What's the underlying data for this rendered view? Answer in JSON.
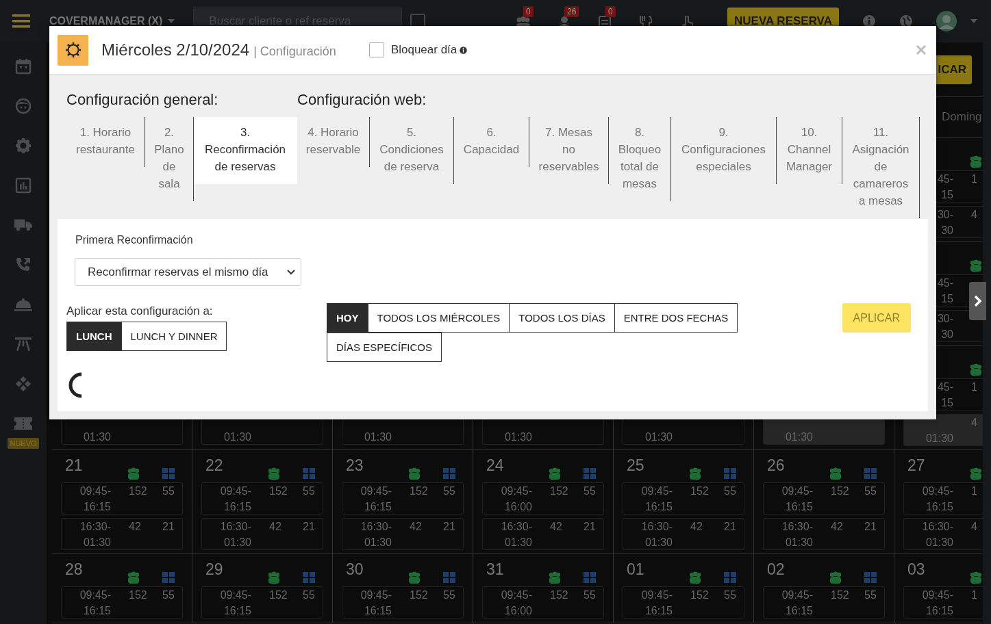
{
  "top_bar": {
    "brand": "COVERMANAGER (X)",
    "search": {
      "placeholder": "Buscar cliente o ref reserva"
    },
    "filter_checked": false,
    "notifications": [
      {
        "count": "0"
      },
      {
        "count": "26"
      },
      {
        "count": "0"
      }
    ],
    "new_button": "NUEVA RESERVA"
  },
  "sidebar": {
    "new_badge": "NUEVO"
  },
  "background": {
    "apply_button": "ICAR",
    "calendar": {
      "header": "Doming",
      "weeks": [
        {
          "cells": [
            {},
            {},
            {},
            {},
            {},
            {},
            {
              "people_icon": true,
              "slots": [
                {
                  "time_start": "45-",
                  "time_end": "15",
                  "covers": "1",
                  "shaded": false
                },
                {
                  "time_start": "30-",
                  "time_end": "30",
                  "covers": "4",
                  "shaded": false
                }
              ]
            }
          ]
        },
        {
          "cells": [
            {},
            {},
            {},
            {},
            {},
            {},
            {
              "people_icon": true,
              "slots": [
                {
                  "time_start": "45-",
                  "time_end": "15",
                  "shaded": false
                },
                {
                  "time_start": "30-",
                  "time_end": "30",
                  "shaded": false
                }
              ]
            }
          ]
        },
        {
          "cells": [
            {
              "slots": [
                {
                  "time_end": "01:30",
                  "shaded": false
                }
              ]
            },
            {
              "slots": [
                {
                  "time_end": "01:30",
                  "shaded": false
                }
              ]
            },
            {
              "slots": [
                {
                  "time_end": "01:30",
                  "shaded": false
                }
              ]
            },
            {
              "slots": [
                {
                  "time_end": "01:30",
                  "shaded": false
                }
              ]
            },
            {
              "slots": [
                {
                  "time_end": "01:30",
                  "shaded": false
                }
              ]
            },
            {
              "slots": [
                {
                  "time_end": "01:30",
                  "shaded": true
                }
              ]
            },
            {
              "people_icon": true,
              "slots": [
                {
                  "time_start": "45-",
                  "time_end": "15",
                  "covers": "1",
                  "shaded": false
                },
                {
                  "time_end": "01:30",
                  "covers": "4",
                  "shaded": true
                }
              ]
            }
          ]
        },
        {
          "cells": [
            {
              "day": "21",
              "people_icon": true,
              "tables_icon": true,
              "slots": [
                {
                  "time_start": "09:45-",
                  "time_end": "16:15",
                  "covers": "152",
                  "tables": "55",
                  "shaded": false
                },
                {
                  "time_start": "16:30-",
                  "time_end": "01:30",
                  "covers": "42",
                  "tables": "21",
                  "shaded": false
                }
              ]
            },
            {
              "day": "22",
              "people_icon": true,
              "tables_icon": true,
              "slots": [
                {
                  "time_start": "09:45-",
                  "time_end": "16:15",
                  "covers": "152",
                  "tables": "55",
                  "shaded": false
                },
                {
                  "time_start": "16:30-",
                  "time_end": "01:30",
                  "covers": "42",
                  "tables": "21",
                  "shaded": false
                }
              ]
            },
            {
              "day": "23",
              "people_icon": true,
              "tables_icon": true,
              "slots": [
                {
                  "time_start": "09:45-",
                  "time_end": "16:15",
                  "covers": "152",
                  "tables": "55",
                  "shaded": false
                },
                {
                  "time_start": "16:30-",
                  "time_end": "01:30",
                  "covers": "42",
                  "tables": "21",
                  "shaded": false
                }
              ]
            },
            {
              "day": "24",
              "people_icon": true,
              "tables_icon": true,
              "slots": [
                {
                  "time_start": "09:45-",
                  "time_end": "16:00",
                  "covers": "152",
                  "tables": "55",
                  "shaded": false
                },
                {
                  "time_start": "16:30-",
                  "time_end": "01:30",
                  "covers": "42",
                  "tables": "21",
                  "shaded": false
                }
              ]
            },
            {
              "day": "25",
              "people_icon": true,
              "tables_icon": true,
              "slots": [
                {
                  "time_start": "09:45-",
                  "time_end": "16:15",
                  "covers": "152",
                  "tables": "55",
                  "shaded": false
                },
                {
                  "time_start": "16:30-",
                  "time_end": "01:30",
                  "covers": "42",
                  "tables": "21",
                  "shaded": false
                }
              ]
            },
            {
              "day": "26",
              "people_icon": true,
              "tables_icon": true,
              "slots": [
                {
                  "time_start": "09:45-",
                  "time_end": "16:15",
                  "covers": "152",
                  "tables": "55",
                  "shaded": false
                },
                {
                  "time_start": "16:30-",
                  "time_end": "01:30",
                  "covers": "42",
                  "tables": "21",
                  "shaded": false
                }
              ]
            },
            {
              "day": "27",
              "people_icon": true,
              "slots": [
                {
                  "time_start": "09:45-",
                  "time_end": "16:15",
                  "covers": "1",
                  "shaded": false
                },
                {
                  "time_start": "16:30-",
                  "time_end": "01:30",
                  "covers": "4",
                  "shaded": false
                }
              ]
            }
          ]
        },
        {
          "cells": [
            {
              "day": "28",
              "people_icon": true,
              "tables_icon": true,
              "slots": [
                {
                  "time_start": "09:45-",
                  "time_end": "16:15",
                  "covers": "152",
                  "tables": "55",
                  "shaded": false
                }
              ]
            },
            {
              "day": "29",
              "people_icon": true,
              "tables_icon": true,
              "slots": [
                {
                  "time_start": "09:45-",
                  "time_end": "16:15",
                  "covers": "152",
                  "tables": "55",
                  "shaded": false
                }
              ]
            },
            {
              "day": "30",
              "people_icon": true,
              "tables_icon": true,
              "slots": [
                {
                  "time_start": "09:45-",
                  "time_end": "16:15",
                  "covers": "152",
                  "tables": "55",
                  "shaded": false
                }
              ]
            },
            {
              "day": "31",
              "people_icon": true,
              "tables_icon": true,
              "slots": [
                {
                  "time_start": "09:45-",
                  "time_end": "16:00",
                  "covers": "152",
                  "tables": "55",
                  "shaded": false
                }
              ]
            },
            {
              "day": "01",
              "people_icon": true,
              "tables_icon": true,
              "slots": [
                {
                  "time_start": "09:45-",
                  "time_end": "16:15",
                  "covers": "152",
                  "tables": "55",
                  "shaded": false
                }
              ]
            },
            {
              "day": "02",
              "people_icon": true,
              "tables_icon": true,
              "slots": [
                {
                  "time_start": "09:45-",
                  "time_end": "16:15",
                  "covers": "152",
                  "tables": "55",
                  "shaded": false
                }
              ]
            },
            {
              "day": "03",
              "people_icon": true,
              "slots": [
                {
                  "time_start": "09:45-",
                  "time_end": "16:15",
                  "covers": "1",
                  "shaded": false
                }
              ]
            }
          ]
        }
      ]
    }
  },
  "modal": {
    "title": "Miércoles 2/10/2024",
    "subtitle": "| Configuración",
    "block_day": {
      "label": "Bloquear día",
      "checked": false
    },
    "sections": [
      "Configuración general:",
      "Configuración web:"
    ],
    "tabs": [
      {
        "label": "1. Horario restaurante",
        "selected": false
      },
      {
        "label": "2. Plano de sala",
        "selected": false
      },
      {
        "label": "3. Reconfirmación de reservas",
        "selected": true
      },
      {
        "label": "4. Horario reservable",
        "selected": false
      },
      {
        "label": "5. Condiciones de reserva",
        "selected": false
      },
      {
        "label": "6. Capacidad",
        "selected": false
      },
      {
        "label": "7. Mesas no reservables",
        "selected": false
      },
      {
        "label": "8. Bloqueo total de mesas",
        "selected": false
      },
      {
        "label": "9. Configuraciones especiales",
        "selected": false
      },
      {
        "label": "10. Channel Manager",
        "selected": false
      },
      {
        "label": "11. Asignación de camareros a mesas",
        "selected": false
      }
    ],
    "first_reconfirmation": {
      "label": "Primera Reconfirmación",
      "value": "Reconfirmar reservas el mismo día"
    },
    "apply_to": {
      "label": "Aplicar esta configuración a:",
      "services": [
        {
          "label": "LUNCH",
          "selected": true
        },
        {
          "label": "LUNCH Y DINNER",
          "selected": false
        }
      ],
      "days": [
        {
          "label": "HOY",
          "selected": true
        },
        {
          "label": "TODOS LOS MIÉRCOLES",
          "selected": false
        },
        {
          "label": "TODOS LOS DÍAS",
          "selected": false
        },
        {
          "label": "ENTRE DOS FECHAS",
          "selected": false
        },
        {
          "label": "DÍAS ESPECÍFICOS",
          "selected": false
        }
      ]
    },
    "apply_button": "APLICAR",
    "loading": true
  }
}
